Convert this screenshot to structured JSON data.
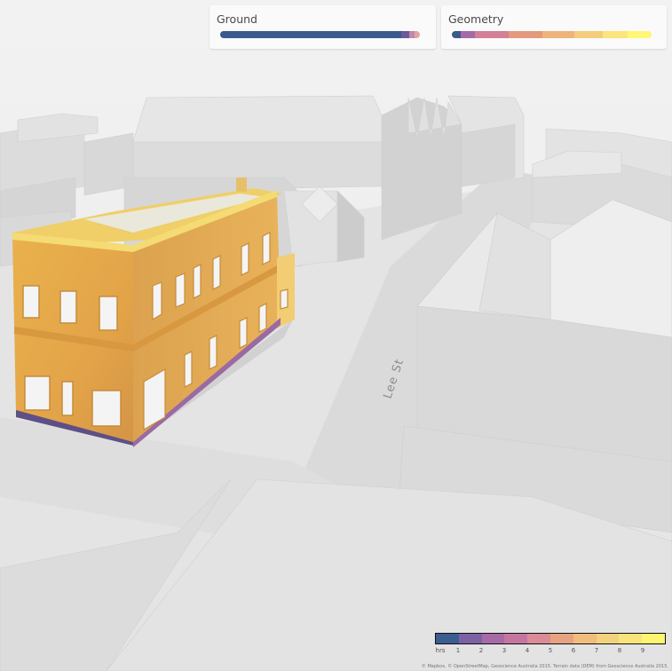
{
  "panels": {
    "ground": {
      "title": "Ground",
      "bar_colors": [
        "#3a5a8c",
        "#6b5a9a",
        "#c087b0",
        "#e0a3a0"
      ]
    },
    "geometry": {
      "title": "Geometry",
      "bar_colors": [
        "#3a5a8c",
        "#a46aa6",
        "#d37f97",
        "#e3997d",
        "#eeb37a",
        "#f2cd7c",
        "#fbe57c",
        "#fff775"
      ]
    }
  },
  "map": {
    "street_label": "Lee St"
  },
  "legend": {
    "unit": "hrs",
    "ticks": [
      "1",
      "2",
      "3",
      "4",
      "5",
      "6",
      "7",
      "8",
      "9"
    ],
    "colors": [
      "#3b5d8f",
      "#7a62a3",
      "#a66aa7",
      "#c4769f",
      "#da8b95",
      "#e6a382",
      "#efbd7c",
      "#f2d27d",
      "#f7e47b",
      "#fff570"
    ]
  },
  "attribution": "© Mapbox, © OpenStreetMap, Geoscience Australia 2015. Terrain data (DEM) from Geoscience Australia 2015."
}
